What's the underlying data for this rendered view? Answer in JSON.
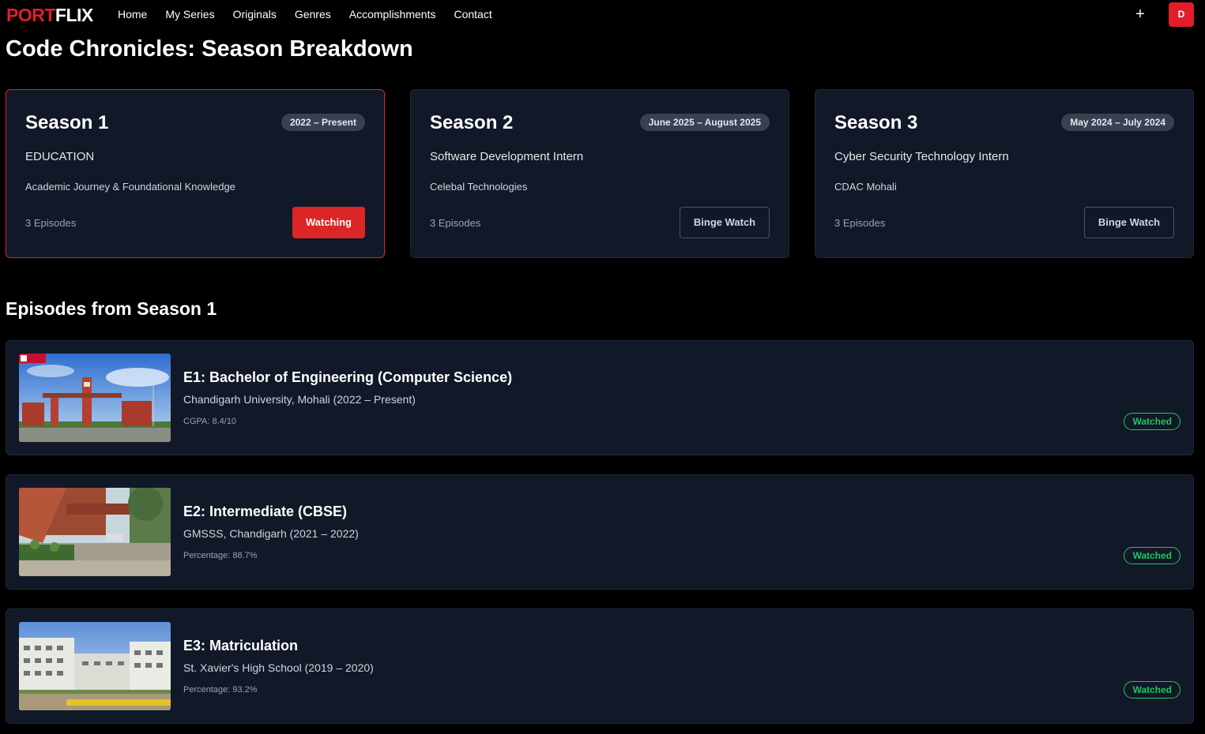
{
  "brand": {
    "part1": "PORT",
    "part2": "FLIX",
    "accent": "#e11d2a"
  },
  "nav": {
    "links": [
      "Home",
      "My Series",
      "Originals",
      "Genres",
      "Accomplishments",
      "Contact"
    ],
    "add_icon": "plus-icon",
    "avatar_initial": "D"
  },
  "page_title": "Code Chronicles: Season Breakdown",
  "seasons": [
    {
      "name": "Season 1",
      "dates": "2022 – Present",
      "role": "EDUCATION",
      "org": "Academic Journey & Foundational Knowledge",
      "episodes": "3 Episodes",
      "action": "Watching",
      "active": true
    },
    {
      "name": "Season 2",
      "dates": "June 2025 – August 2025",
      "role": "Software Development Intern",
      "org": "Celebal Technologies",
      "episodes": "3 Episodes",
      "action": "Binge Watch",
      "active": false
    },
    {
      "name": "Season 3",
      "dates": "May 2024 – July 2024",
      "role": "Cyber Security Technology Intern",
      "org": "CDAC Mohali",
      "episodes": "3 Episodes",
      "action": "Binge Watch",
      "active": false
    }
  ],
  "episodes_title": "Episodes from Season 1",
  "episodes": [
    {
      "title": "E1: Bachelor of Engineering (Computer Science)",
      "sub": "Chandigarh University, Mohali (2022 – Present)",
      "meta": "CGPA: 8.4/10",
      "status": "Watched"
    },
    {
      "title": "E2: Intermediate (CBSE)",
      "sub": "GMSSS, Chandigarh (2021 – 2022)",
      "meta": "Percentage: 88.7%",
      "status": "Watched"
    },
    {
      "title": "E3: Matriculation",
      "sub": "St. Xavier's High School (2019 – 2020)",
      "meta": "Percentage: 93.2%",
      "status": "Watched"
    }
  ]
}
